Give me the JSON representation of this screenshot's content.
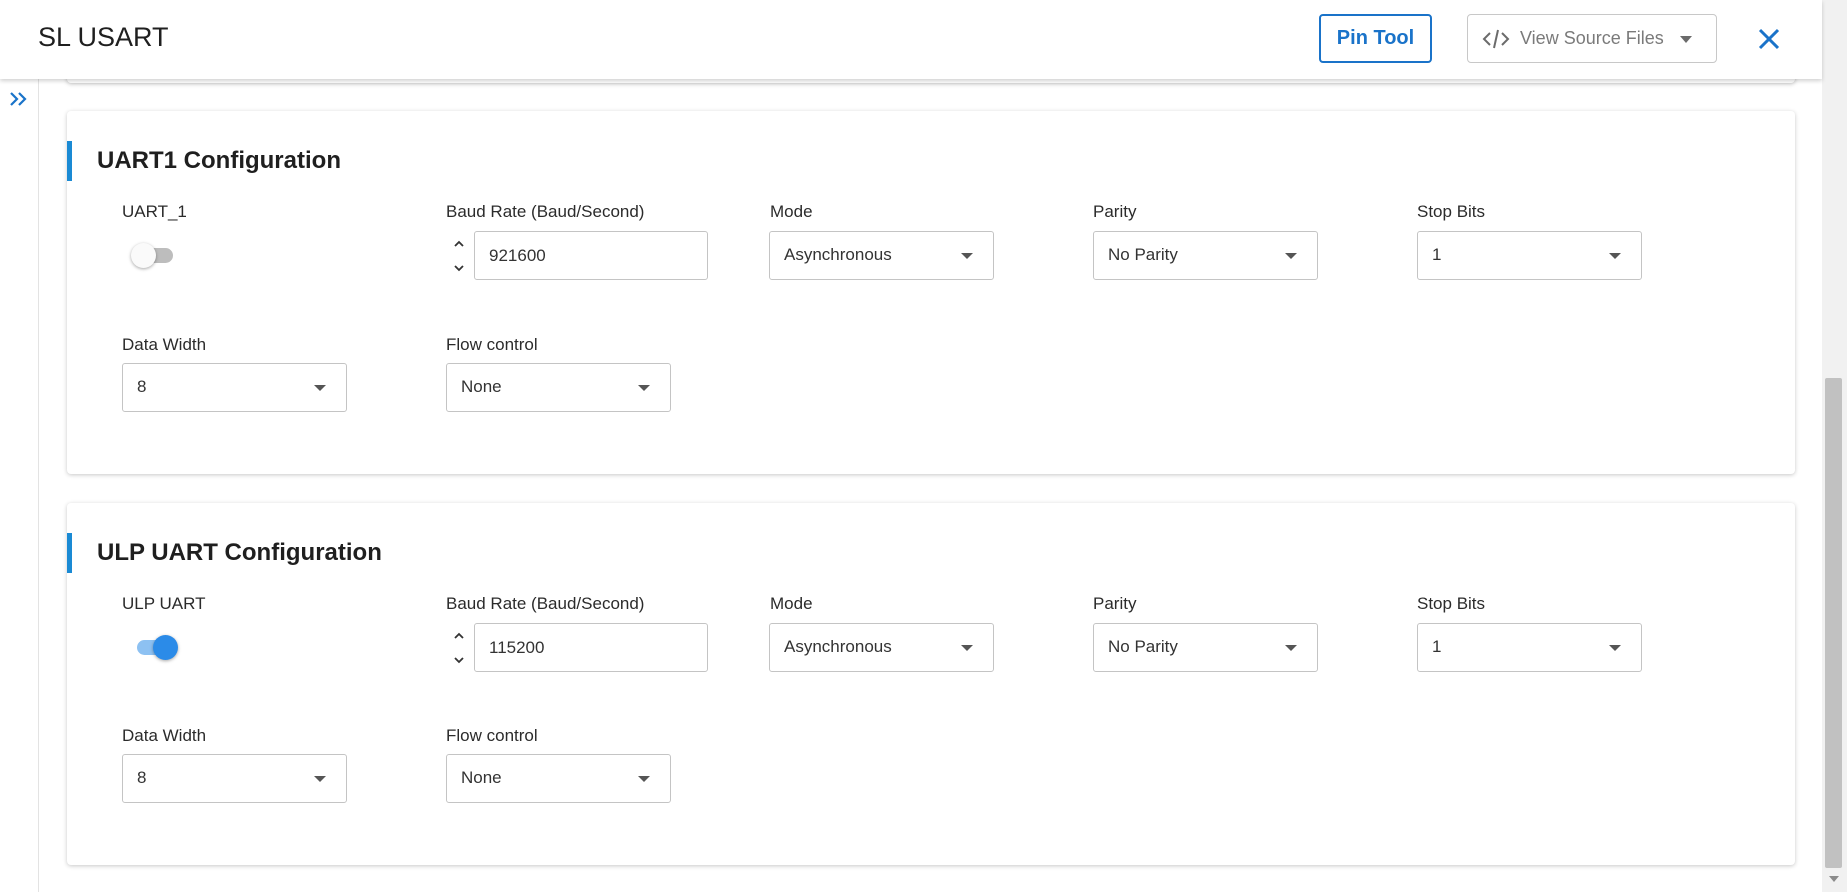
{
  "header": {
    "title": "SL USART",
    "pin_tool_label": "Pin Tool",
    "view_source_label": "View Source Files"
  },
  "colors": {
    "accent": "#1a8ad4",
    "primary": "#1a73c9",
    "toggle_on": "#2b8be8",
    "toggle_off": "#bdbdbd"
  },
  "uart1": {
    "title": "UART1 Configuration",
    "toggle_label": "UART_1",
    "enabled": false,
    "baud_label": "Baud Rate (Baud/Second)",
    "baud_value": "921600",
    "mode_label": "Mode",
    "mode_value": "Asynchronous",
    "parity_label": "Parity",
    "parity_value": "No Parity",
    "stop_bits_label": "Stop Bits",
    "stop_bits_value": "1",
    "data_width_label": "Data Width",
    "data_width_value": "8",
    "flow_label": "Flow control",
    "flow_value": "None"
  },
  "ulp_uart": {
    "title": "ULP UART Configuration",
    "toggle_label": "ULP UART",
    "enabled": true,
    "baud_label": "Baud Rate (Baud/Second)",
    "baud_value": "115200",
    "mode_label": "Mode",
    "mode_value": "Asynchronous",
    "parity_label": "Parity",
    "parity_value": "No Parity",
    "stop_bits_label": "Stop Bits",
    "stop_bits_value": "1",
    "data_width_label": "Data Width",
    "data_width_value": "8",
    "flow_label": "Flow control",
    "flow_value": "None"
  }
}
